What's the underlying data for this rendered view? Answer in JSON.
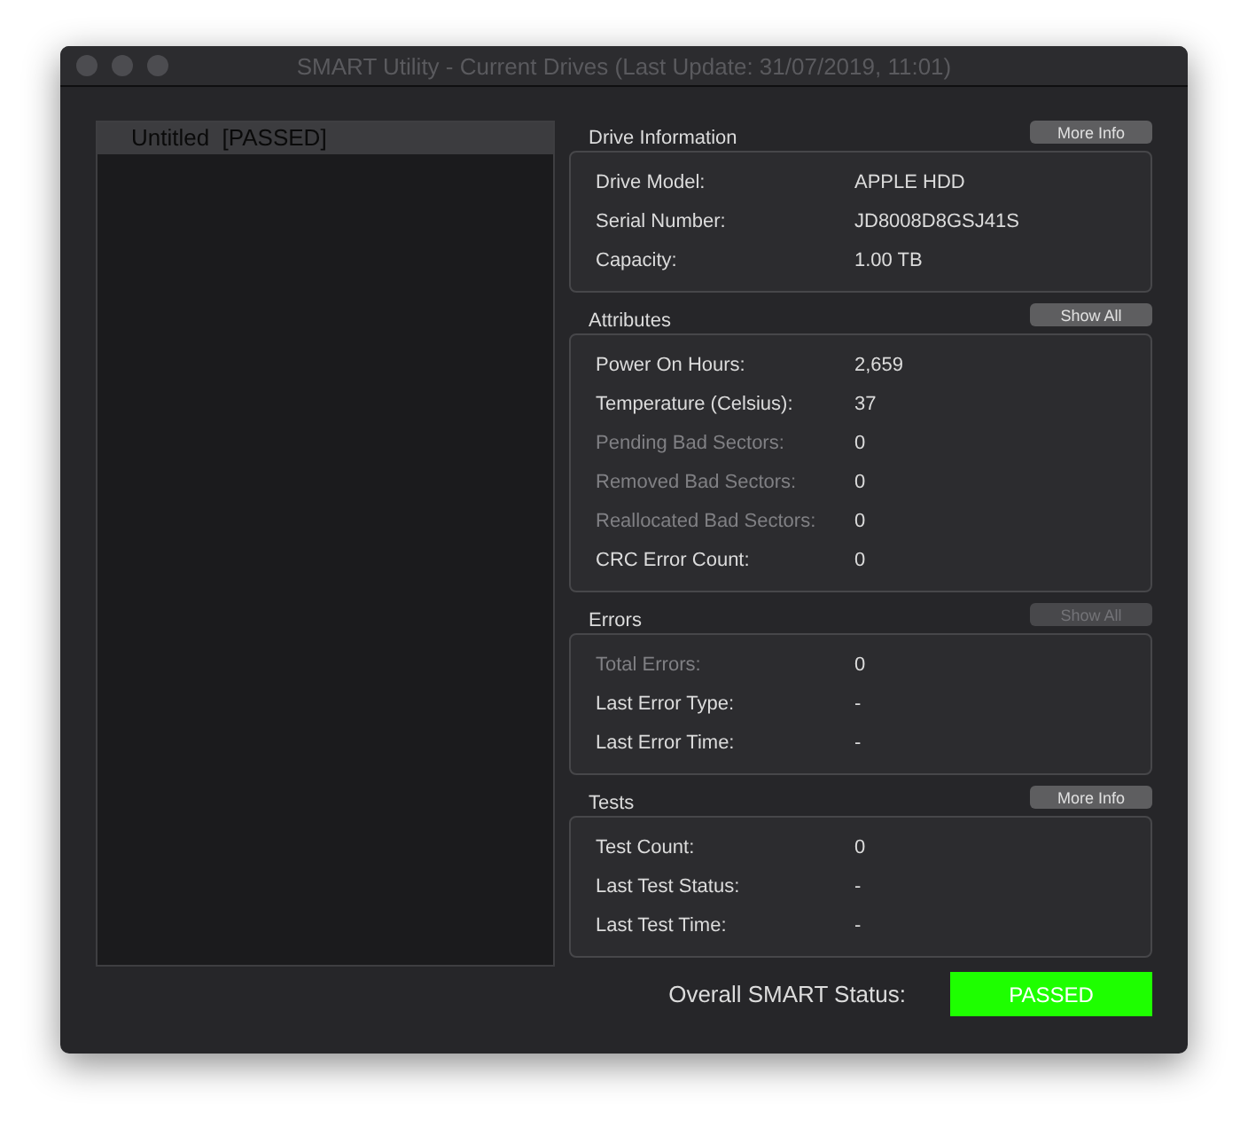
{
  "window": {
    "title": "SMART Utility - Current Drives (Last Update: 31/07/2019, 11:01)"
  },
  "drives": [
    {
      "label": "Untitled  [PASSED]",
      "selected": true
    }
  ],
  "sections": [
    {
      "title": "Drive Information",
      "button": {
        "label": "More Info",
        "disabled": false
      },
      "rows": [
        {
          "label": "Drive Model:",
          "value": "APPLE HDD",
          "dimmed": false
        },
        {
          "label": "Serial Number:",
          "value": "JD8008D8GSJ41S",
          "dimmed": false
        },
        {
          "label": "Capacity:",
          "value": "1.00 TB",
          "dimmed": false
        }
      ]
    },
    {
      "title": "Attributes",
      "button": {
        "label": "Show All",
        "disabled": false
      },
      "rows": [
        {
          "label": "Power On Hours:",
          "value": "2,659",
          "dimmed": false
        },
        {
          "label": "Temperature (Celsius):",
          "value": "37",
          "dimmed": false
        },
        {
          "label": "Pending Bad Sectors:",
          "value": "0",
          "dimmed": true
        },
        {
          "label": "Removed Bad Sectors:",
          "value": "0",
          "dimmed": true
        },
        {
          "label": "Reallocated Bad Sectors:",
          "value": "0",
          "dimmed": true
        },
        {
          "label": "CRC Error Count:",
          "value": "0",
          "dimmed": false
        }
      ]
    },
    {
      "title": "Errors",
      "button": {
        "label": "Show All",
        "disabled": true
      },
      "rows": [
        {
          "label": "Total Errors:",
          "value": "0",
          "dimmed": true
        },
        {
          "label": "Last Error Type:",
          "value": "-",
          "dimmed": false
        },
        {
          "label": "Last Error Time:",
          "value": "-",
          "dimmed": false
        }
      ]
    },
    {
      "title": "Tests",
      "button": {
        "label": "More Info",
        "disabled": false
      },
      "rows": [
        {
          "label": "Test Count:",
          "value": "0",
          "dimmed": false
        },
        {
          "label": "Last Test Status:",
          "value": "-",
          "dimmed": false
        },
        {
          "label": "Last Test Time:",
          "value": "-",
          "dimmed": false
        }
      ]
    }
  ],
  "overall": {
    "label": "Overall SMART Status:",
    "status": "PASSED",
    "color": "#1eff00"
  }
}
